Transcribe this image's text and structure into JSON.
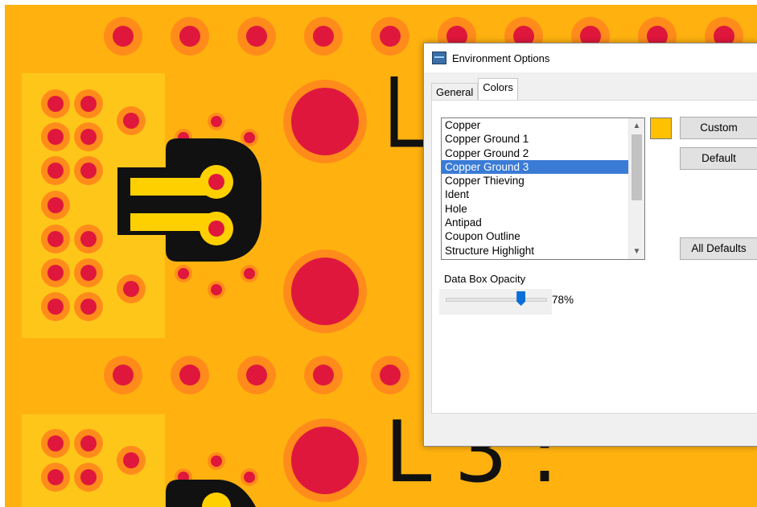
{
  "dialog": {
    "title": "Environment Options",
    "tabs": [
      {
        "label": "General",
        "active": false
      },
      {
        "label": "Colors",
        "active": true
      }
    ],
    "color_list": {
      "items": [
        "Copper",
        "Copper Ground 1",
        "Copper Ground 2",
        "Copper Ground 3",
        "Copper Thieving",
        "Ident",
        "Hole",
        "Antipad",
        "Coupon Outline",
        "Structure Highlight"
      ],
      "selected": "Copper Ground 3"
    },
    "swatch_color": "#ffc000",
    "buttons": {
      "custom": "Custom",
      "default": "Default",
      "all_defaults": "All Defaults"
    },
    "opacity": {
      "label": "Data Box Opacity",
      "value_text": "78%",
      "value": 0.78
    }
  },
  "board": {
    "background_color": "#ffb20f",
    "pad_ring_color": "#ff8c1a",
    "pad_center_color": "#e0173c",
    "trace_color": "#ffd000",
    "outline_color": "#111111",
    "label_text": "L3:"
  }
}
